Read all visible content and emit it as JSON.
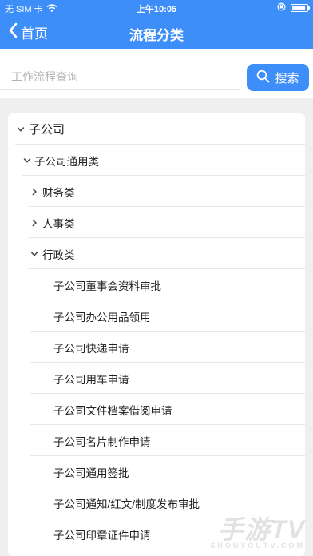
{
  "status_bar": {
    "carrier": "无 SIM 卡",
    "time": "上午10:05",
    "wifi_icon": "wifi-icon",
    "lock_icon": "rotation-lock-icon",
    "battery_level": 0.9
  },
  "nav": {
    "back_label": "首页",
    "title": "流程分类",
    "bar_color": "#3d8ef8"
  },
  "search": {
    "placeholder": "工作流程查询",
    "value": "",
    "button_label": "搜索"
  },
  "tree": {
    "items": [
      {
        "label": "子公司",
        "level": 0,
        "state": "expanded"
      },
      {
        "label": "子公司通用类",
        "level": 1,
        "state": "expanded"
      },
      {
        "label": "财务类",
        "level": 2,
        "state": "collapsed"
      },
      {
        "label": "人事类",
        "level": 2,
        "state": "collapsed"
      },
      {
        "label": "行政类",
        "level": 2,
        "state": "expanded"
      },
      {
        "label": "子公司董事会资料审批",
        "level": 3,
        "state": "leaf"
      },
      {
        "label": "子公司办公用品领用",
        "level": 3,
        "state": "leaf"
      },
      {
        "label": "子公司快递申请",
        "level": 3,
        "state": "leaf"
      },
      {
        "label": "子公司用车申请",
        "level": 3,
        "state": "leaf"
      },
      {
        "label": "子公司文件档案借阅申请",
        "level": 3,
        "state": "leaf"
      },
      {
        "label": "子公司名片制作申请",
        "level": 3,
        "state": "leaf"
      },
      {
        "label": "子公司通用签批",
        "level": 3,
        "state": "leaf"
      },
      {
        "label": "子公司通知/红文/制度发布审批",
        "level": 3,
        "state": "leaf"
      },
      {
        "label": "子公司印章证件申请",
        "level": 3,
        "state": "leaf"
      }
    ]
  },
  "watermark": {
    "text": "手游TV",
    "subtext": "SHOUYOUTV.COM"
  }
}
